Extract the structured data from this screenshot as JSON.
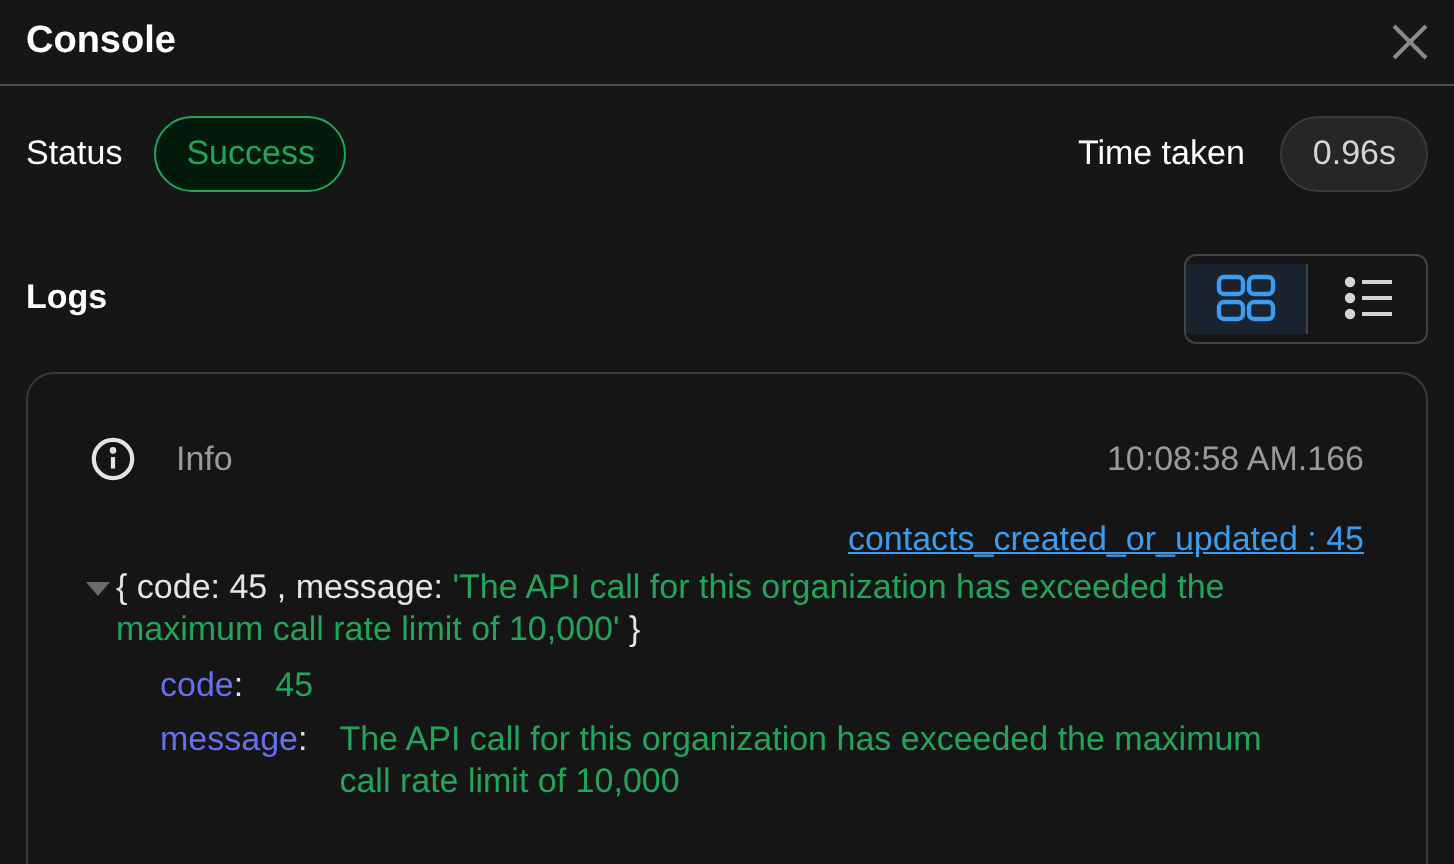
{
  "title": "Console",
  "status": {
    "label": "Status",
    "value": "Success"
  },
  "time": {
    "label": "Time taken",
    "value": "0.96s"
  },
  "logs": {
    "label": "Logs",
    "views": [
      {
        "kind": "grid",
        "selected": true
      },
      {
        "kind": "list",
        "selected": false
      }
    ],
    "entry": {
      "level": "Info",
      "timestamp": "10:08:58 AM.166",
      "link": "contacts_created_or_updated : 45",
      "expanded": true,
      "summary": [
        {
          "kind": "punct",
          "text": "{ "
        },
        {
          "kind": "key",
          "text": "code: "
        },
        {
          "kind": "num",
          "text": "45"
        },
        {
          "kind": "punct",
          "text": " , "
        },
        {
          "kind": "key",
          "text": "message: "
        },
        {
          "kind": "str",
          "text": "'The API call for this organization has exceeded the maximum call rate limit of 10,000'"
        },
        {
          "kind": "punct",
          "text": " }"
        }
      ],
      "fields": [
        {
          "key": "code",
          "separator": ":",
          "value": "45"
        },
        {
          "key": "message",
          "separator": ":",
          "value": "The API call for this organization has exceeded the maximum call rate limit of 10,000"
        }
      ]
    }
  }
}
